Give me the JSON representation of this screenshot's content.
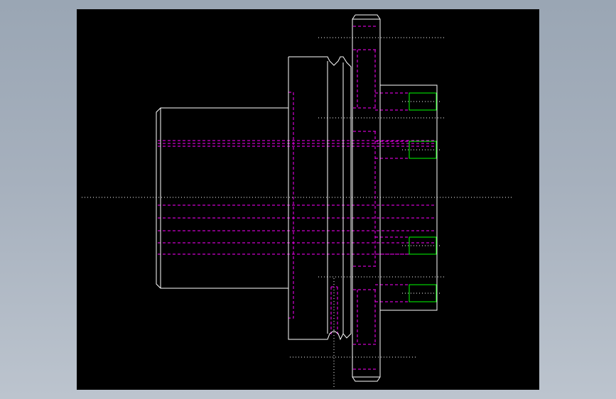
{
  "drawing": {
    "background": "#000000",
    "outline_color": "#ffffff",
    "hidden_line_color": "#ff00ff",
    "center_line_color": "#ffffff",
    "thread_color": "#00ff00"
  }
}
